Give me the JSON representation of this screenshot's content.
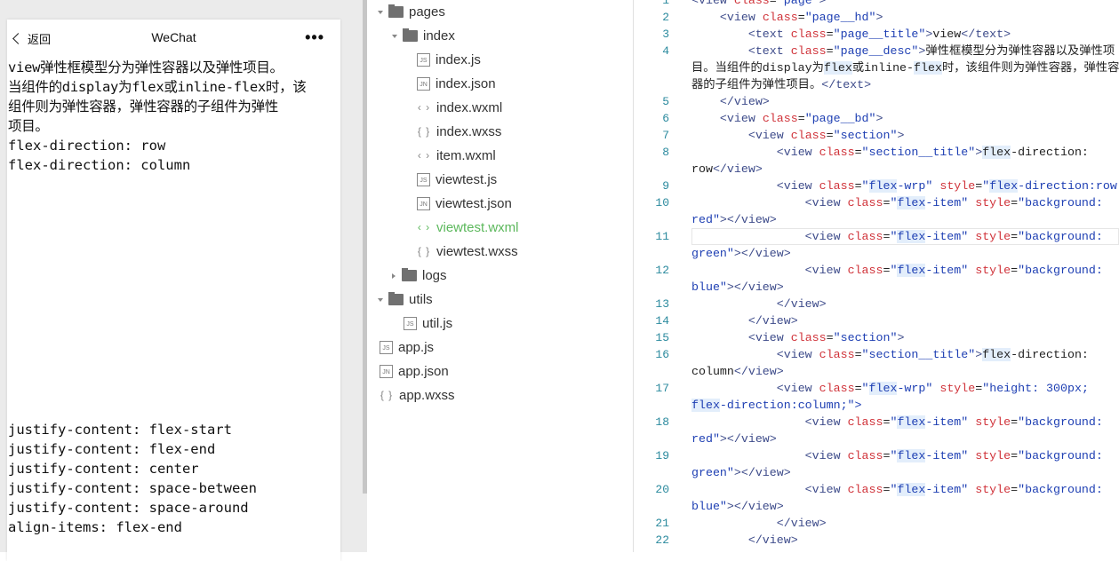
{
  "simulator": {
    "nav": {
      "back_label": "返回",
      "title": "WeChat",
      "more_icon": "ellipsis-icon"
    },
    "description": "view弹性框模型分为弹性容器以及弹性项目。当组件的display为flex或inline-flex时，该组件则为弹性容器，弹性容器的子组件为弹性项目。",
    "description_lines": [
      "view弹性框模型分为弹性容器以及弹性项目。",
      "当组件的display为flex或inline-flex时，该",
      "组件则为弹性容器，弹性容器的子组件为弹性",
      "项目。"
    ],
    "sections_top": [
      "flex-direction: row",
      "flex-direction: column"
    ],
    "sections_bottom": [
      "justify-content: flex-start",
      "justify-content: flex-end",
      "justify-content: center",
      "justify-content: space-between",
      "justify-content: space-around",
      "align-items: flex-end"
    ]
  },
  "file_tree": [
    {
      "label": "pages",
      "type": "folder",
      "open": true,
      "depth": 0
    },
    {
      "label": "index",
      "type": "folder",
      "open": true,
      "depth": 1
    },
    {
      "label": "index.js",
      "type": "js",
      "depth": 2
    },
    {
      "label": "index.json",
      "type": "json",
      "depth": 2
    },
    {
      "label": "index.wxml",
      "type": "wxml",
      "depth": 2
    },
    {
      "label": "index.wxss",
      "type": "wxss",
      "depth": 2
    },
    {
      "label": "item.wxml",
      "type": "wxml",
      "depth": 2
    },
    {
      "label": "viewtest.js",
      "type": "js",
      "depth": 2
    },
    {
      "label": "viewtest.json",
      "type": "json",
      "depth": 2
    },
    {
      "label": "viewtest.wxml",
      "type": "wxml",
      "depth": 2,
      "active": true
    },
    {
      "label": "viewtest.wxss",
      "type": "wxss",
      "depth": 2
    },
    {
      "label": "logs",
      "type": "folder",
      "open": false,
      "depth": 1
    },
    {
      "label": "utils",
      "type": "folder",
      "open": true,
      "depth": 0
    },
    {
      "label": "util.js",
      "type": "js",
      "depth": 1,
      "flat": true
    },
    {
      "label": "app.js",
      "type": "js",
      "depth": 0,
      "flat": true
    },
    {
      "label": "app.json",
      "type": "json",
      "depth": 0,
      "flat": true
    },
    {
      "label": "app.wxss",
      "type": "wxss",
      "depth": 0,
      "flat": true
    }
  ],
  "file_icons": {
    "js": "JS",
    "json": "JN",
    "wxml": "‹ ›",
    "wxss": "{ }"
  },
  "colors": {
    "active_file": "#5cb85c",
    "tag": "#3d4b8a",
    "attr": "#d0333a",
    "string": "#1e3fb3",
    "line_number": "#2b8a9e"
  },
  "editor": {
    "current_line": 11,
    "rows": [
      {
        "n": "1",
        "t": [
          [
            "tag",
            "<view "
          ],
          [
            "attr",
            "class"
          ],
          [
            "txt",
            "="
          ],
          [
            "str",
            "\"page\""
          ],
          [
            "tag",
            ">"
          ]
        ]
      },
      {
        "n": "2",
        "t": [
          [
            "txt",
            "    "
          ],
          [
            "tag",
            "<view "
          ],
          [
            "attr",
            "class"
          ],
          [
            "txt",
            "="
          ],
          [
            "str",
            "\"page__hd\""
          ],
          [
            "tag",
            ">"
          ]
        ]
      },
      {
        "n": "3",
        "t": [
          [
            "txt",
            "        "
          ],
          [
            "tag",
            "<text "
          ],
          [
            "attr",
            "class"
          ],
          [
            "txt",
            "="
          ],
          [
            "str",
            "\"page__title\""
          ],
          [
            "tag",
            ">"
          ],
          [
            "txt",
            "view"
          ],
          [
            "tag",
            "</text>"
          ]
        ]
      },
      {
        "n": "4",
        "t": [
          [
            "txt",
            "        "
          ],
          [
            "tag",
            "<text "
          ],
          [
            "attr",
            "class"
          ],
          [
            "txt",
            "="
          ],
          [
            "str",
            "\"page__desc\""
          ],
          [
            "tag",
            ">"
          ],
          [
            "txt",
            "弹性框模型分为弹性容器以及弹性项"
          ]
        ]
      },
      {
        "n": "",
        "t": [
          [
            "txt",
            "目。当组件的display为"
          ],
          [
            "txthl",
            "flex"
          ],
          [
            "txt",
            "或inline-"
          ],
          [
            "txthl",
            "flex"
          ],
          [
            "txt",
            "时，该组件则为弹性容器，弹性容"
          ]
        ]
      },
      {
        "n": "",
        "t": [
          [
            "txt",
            "器的子组件为弹性项目。"
          ],
          [
            "tag",
            "</text>"
          ]
        ]
      },
      {
        "n": "5",
        "t": [
          [
            "txt",
            "    "
          ],
          [
            "tag",
            "</view>"
          ]
        ]
      },
      {
        "n": "6",
        "t": [
          [
            "txt",
            "    "
          ],
          [
            "tag",
            "<view "
          ],
          [
            "attr",
            "class"
          ],
          [
            "txt",
            "="
          ],
          [
            "str",
            "\"page__bd\""
          ],
          [
            "tag",
            ">"
          ]
        ]
      },
      {
        "n": "7",
        "t": [
          [
            "txt",
            "        "
          ],
          [
            "tag",
            "<view "
          ],
          [
            "attr",
            "class"
          ],
          [
            "txt",
            "="
          ],
          [
            "str",
            "\"section\""
          ],
          [
            "tag",
            ">"
          ]
        ]
      },
      {
        "n": "8",
        "t": [
          [
            "txt",
            "            "
          ],
          [
            "tag",
            "<view "
          ],
          [
            "attr",
            "class"
          ],
          [
            "txt",
            "="
          ],
          [
            "str",
            "\"section__title\""
          ],
          [
            "tag",
            ">"
          ],
          [
            "txthl",
            "flex"
          ],
          [
            "txt",
            "-direction:"
          ]
        ]
      },
      {
        "n": "",
        "t": [
          [
            "txt",
            "row"
          ],
          [
            "tag",
            "</view>"
          ]
        ]
      },
      {
        "n": "9",
        "t": [
          [
            "txt",
            "            "
          ],
          [
            "tag",
            "<view "
          ],
          [
            "attr",
            "class"
          ],
          [
            "txt",
            "="
          ],
          [
            "str",
            "\""
          ],
          [
            "strhl",
            "flex"
          ],
          [
            "str",
            "-wrp\" "
          ],
          [
            "attr",
            "style"
          ],
          [
            "txt",
            "="
          ],
          [
            "str",
            "\""
          ],
          [
            "strhl",
            "flex"
          ],
          [
            "str",
            "-direction:row;\">"
          ]
        ]
      },
      {
        "n": "10",
        "t": [
          [
            "txt",
            "                "
          ],
          [
            "tag",
            "<view "
          ],
          [
            "attr",
            "class"
          ],
          [
            "txt",
            "="
          ],
          [
            "str",
            "\""
          ],
          [
            "strhl",
            "flex"
          ],
          [
            "str",
            "-item\" "
          ],
          [
            "attr",
            "style"
          ],
          [
            "txt",
            "="
          ],
          [
            "str",
            "\"background:"
          ]
        ]
      },
      {
        "n": "",
        "t": [
          [
            "str",
            "red\""
          ],
          [
            "tag",
            "></view>"
          ]
        ]
      },
      {
        "n": "11",
        "t": [
          [
            "txt",
            "                "
          ],
          [
            "tag",
            "<view "
          ],
          [
            "attr",
            "class"
          ],
          [
            "txt",
            "="
          ],
          [
            "str",
            "\""
          ],
          [
            "strhl",
            "flex"
          ],
          [
            "str",
            "-item\" "
          ],
          [
            "attr",
            "style"
          ],
          [
            "txt",
            "="
          ],
          [
            "str",
            "\"background:"
          ]
        ]
      },
      {
        "n": "",
        "t": [
          [
            "str",
            "green\""
          ],
          [
            "tag",
            "></view>"
          ]
        ]
      },
      {
        "n": "12",
        "t": [
          [
            "txt",
            "                "
          ],
          [
            "tag",
            "<view "
          ],
          [
            "attr",
            "class"
          ],
          [
            "txt",
            "="
          ],
          [
            "str",
            "\""
          ],
          [
            "strhl",
            "flex"
          ],
          [
            "str",
            "-item\" "
          ],
          [
            "attr",
            "style"
          ],
          [
            "txt",
            "="
          ],
          [
            "str",
            "\"background:"
          ]
        ]
      },
      {
        "n": "",
        "t": [
          [
            "str",
            "blue\""
          ],
          [
            "tag",
            "></view>"
          ]
        ]
      },
      {
        "n": "13",
        "t": [
          [
            "txt",
            "            "
          ],
          [
            "tag",
            "</view>"
          ]
        ]
      },
      {
        "n": "14",
        "t": [
          [
            "txt",
            "        "
          ],
          [
            "tag",
            "</view>"
          ]
        ]
      },
      {
        "n": "15",
        "t": [
          [
            "txt",
            "        "
          ],
          [
            "tag",
            "<view "
          ],
          [
            "attr",
            "class"
          ],
          [
            "txt",
            "="
          ],
          [
            "str",
            "\"section\""
          ],
          [
            "tag",
            ">"
          ]
        ]
      },
      {
        "n": "16",
        "t": [
          [
            "txt",
            "            "
          ],
          [
            "tag",
            "<view "
          ],
          [
            "attr",
            "class"
          ],
          [
            "txt",
            "="
          ],
          [
            "str",
            "\"section__title\""
          ],
          [
            "tag",
            ">"
          ],
          [
            "txthl",
            "flex"
          ],
          [
            "txt",
            "-direction:"
          ]
        ]
      },
      {
        "n": "",
        "t": [
          [
            "txt",
            "column"
          ],
          [
            "tag",
            "</view>"
          ]
        ]
      },
      {
        "n": "17",
        "t": [
          [
            "txt",
            "            "
          ],
          [
            "tag",
            "<view "
          ],
          [
            "attr",
            "class"
          ],
          [
            "txt",
            "="
          ],
          [
            "str",
            "\""
          ],
          [
            "strhl",
            "flex"
          ],
          [
            "str",
            "-wrp\" "
          ],
          [
            "attr",
            "style"
          ],
          [
            "txt",
            "="
          ],
          [
            "str",
            "\"height: 300px;"
          ]
        ]
      },
      {
        "n": "",
        "t": [
          [
            "strhl",
            "flex"
          ],
          [
            "str",
            "-direction:column;\">"
          ]
        ]
      },
      {
        "n": "18",
        "t": [
          [
            "txt",
            "                "
          ],
          [
            "tag",
            "<view "
          ],
          [
            "attr",
            "class"
          ],
          [
            "txt",
            "="
          ],
          [
            "str",
            "\""
          ],
          [
            "strhl",
            "flex"
          ],
          [
            "str",
            "-item\" "
          ],
          [
            "attr",
            "style"
          ],
          [
            "txt",
            "="
          ],
          [
            "str",
            "\"background:"
          ]
        ]
      },
      {
        "n": "",
        "t": [
          [
            "str",
            "red\""
          ],
          [
            "tag",
            "></view>"
          ]
        ]
      },
      {
        "n": "19",
        "t": [
          [
            "txt",
            "                "
          ],
          [
            "tag",
            "<view "
          ],
          [
            "attr",
            "class"
          ],
          [
            "txt",
            "="
          ],
          [
            "str",
            "\""
          ],
          [
            "strhl",
            "flex"
          ],
          [
            "str",
            "-item\" "
          ],
          [
            "attr",
            "style"
          ],
          [
            "txt",
            "="
          ],
          [
            "str",
            "\"background:"
          ]
        ]
      },
      {
        "n": "",
        "t": [
          [
            "str",
            "green\""
          ],
          [
            "tag",
            "></view>"
          ]
        ]
      },
      {
        "n": "20",
        "t": [
          [
            "txt",
            "                "
          ],
          [
            "tag",
            "<view "
          ],
          [
            "attr",
            "class"
          ],
          [
            "txt",
            "="
          ],
          [
            "str",
            "\""
          ],
          [
            "strhl",
            "flex"
          ],
          [
            "str",
            "-item\" "
          ],
          [
            "attr",
            "style"
          ],
          [
            "txt",
            "="
          ],
          [
            "str",
            "\"background:"
          ]
        ]
      },
      {
        "n": "",
        "t": [
          [
            "str",
            "blue\""
          ],
          [
            "tag",
            "></view>"
          ]
        ]
      },
      {
        "n": "21",
        "t": [
          [
            "txt",
            "            "
          ],
          [
            "tag",
            "</view>"
          ]
        ]
      },
      {
        "n": "22",
        "t": [
          [
            "txt",
            "        "
          ],
          [
            "tag",
            "</view>"
          ]
        ]
      }
    ]
  }
}
